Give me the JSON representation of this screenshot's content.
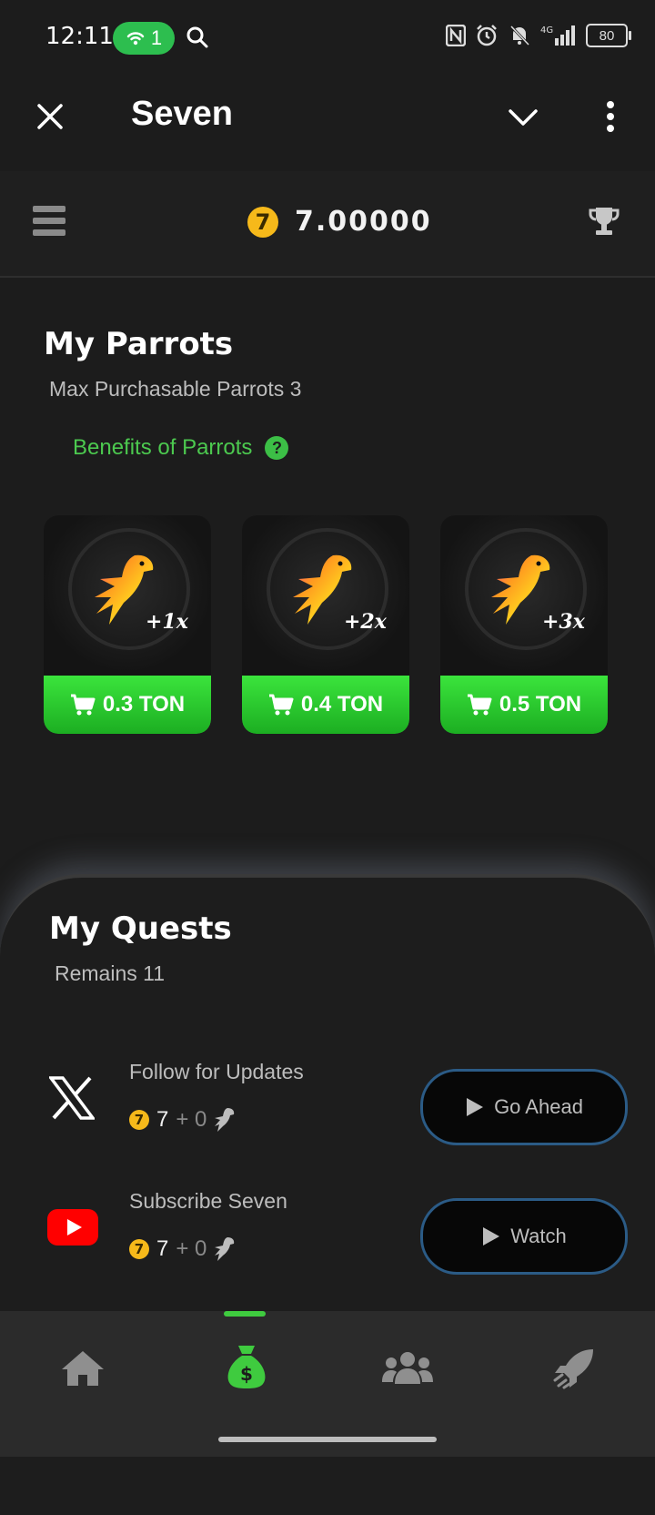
{
  "status_bar": {
    "time": "12:11",
    "hotspot_count": "1",
    "battery": "80",
    "network": "4G"
  },
  "app_bar": {
    "title": "Seven"
  },
  "header": {
    "coin_symbol": "7",
    "balance": "7.00000"
  },
  "parrots": {
    "title": "My Parrots",
    "max_label": "Max Purchasable Parrots 3",
    "benefits_link": "Benefits of Parrots",
    "help_symbol": "?",
    "cards": [
      {
        "multiplier": "+1x",
        "price": "0.3 TON"
      },
      {
        "multiplier": "+2x",
        "price": "0.4 TON"
      },
      {
        "multiplier": "+3x",
        "price": "0.5 TON"
      }
    ]
  },
  "quests": {
    "title": "My Quests",
    "remains": "Remains 11",
    "items": [
      {
        "icon": "x-logo-icon",
        "title": "Follow for Updates",
        "reward_coin": "7",
        "reward_coins": "7",
        "reward_plus": "+ 0",
        "action": "Go Ahead"
      },
      {
        "icon": "youtube-logo-icon",
        "title": "Subscribe Seven",
        "reward_coin": "7",
        "reward_coins": "7",
        "reward_plus": "+ 0",
        "action": "Watch"
      }
    ]
  },
  "nav": {
    "items": [
      "home-icon",
      "money-bag-icon",
      "friends-icon",
      "boost-icon"
    ],
    "active": "money-bag-icon"
  },
  "colors": {
    "accent_green": "#3be43c",
    "coin_gold": "#f6b91a",
    "button_border_blue": "#2b5b86",
    "background": "#1c1c1c"
  }
}
